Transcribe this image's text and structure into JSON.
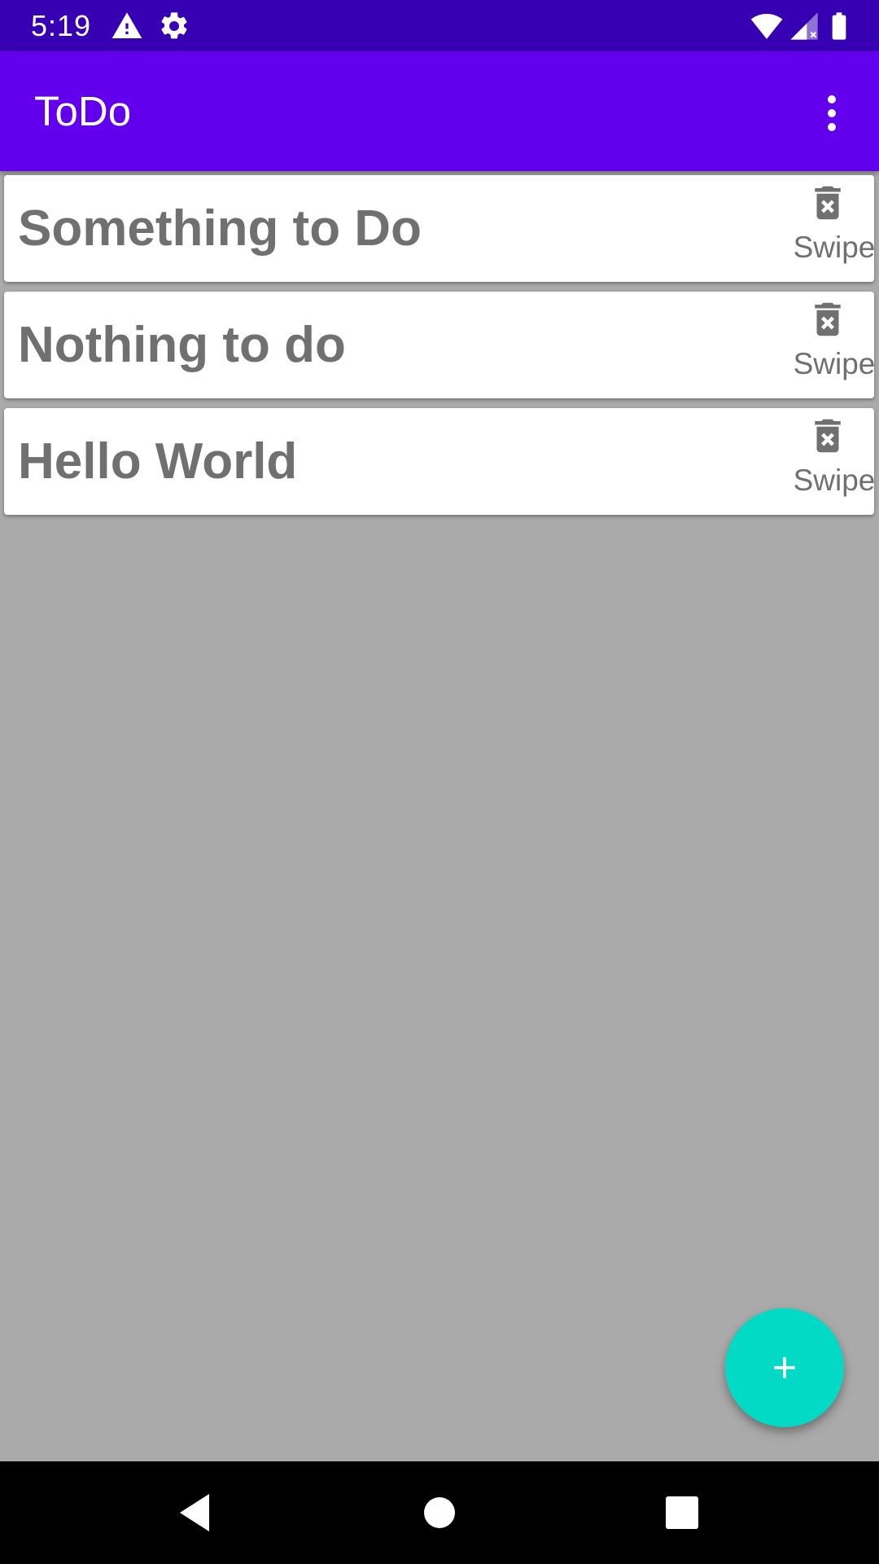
{
  "status_bar": {
    "time": "5:19",
    "icons": [
      "alert-icon",
      "settings-icon",
      "wifi-icon",
      "cell-signal-icon",
      "battery-icon"
    ],
    "background": "#3700b3"
  },
  "app_bar": {
    "title": "ToDo",
    "overflow_icon": "more-vert-icon",
    "background": "#6200ee"
  },
  "todos": [
    {
      "title": "Something to Do",
      "delete_icon": "delete-forever-icon",
      "hint": "Swipe"
    },
    {
      "title": "Nothing to do",
      "delete_icon": "delete-forever-icon",
      "hint": "Swipe"
    },
    {
      "title": "Hello World",
      "delete_icon": "delete-forever-icon",
      "hint": "Swipe"
    }
  ],
  "fab": {
    "icon": "plus-icon",
    "color": "#03dac5"
  },
  "nav_bar": {
    "icons": [
      "back-icon",
      "home-icon",
      "recents-icon"
    ]
  },
  "colors": {
    "list_background": "#aaaaaa",
    "card": "#ffffff",
    "text": "#707070"
  }
}
